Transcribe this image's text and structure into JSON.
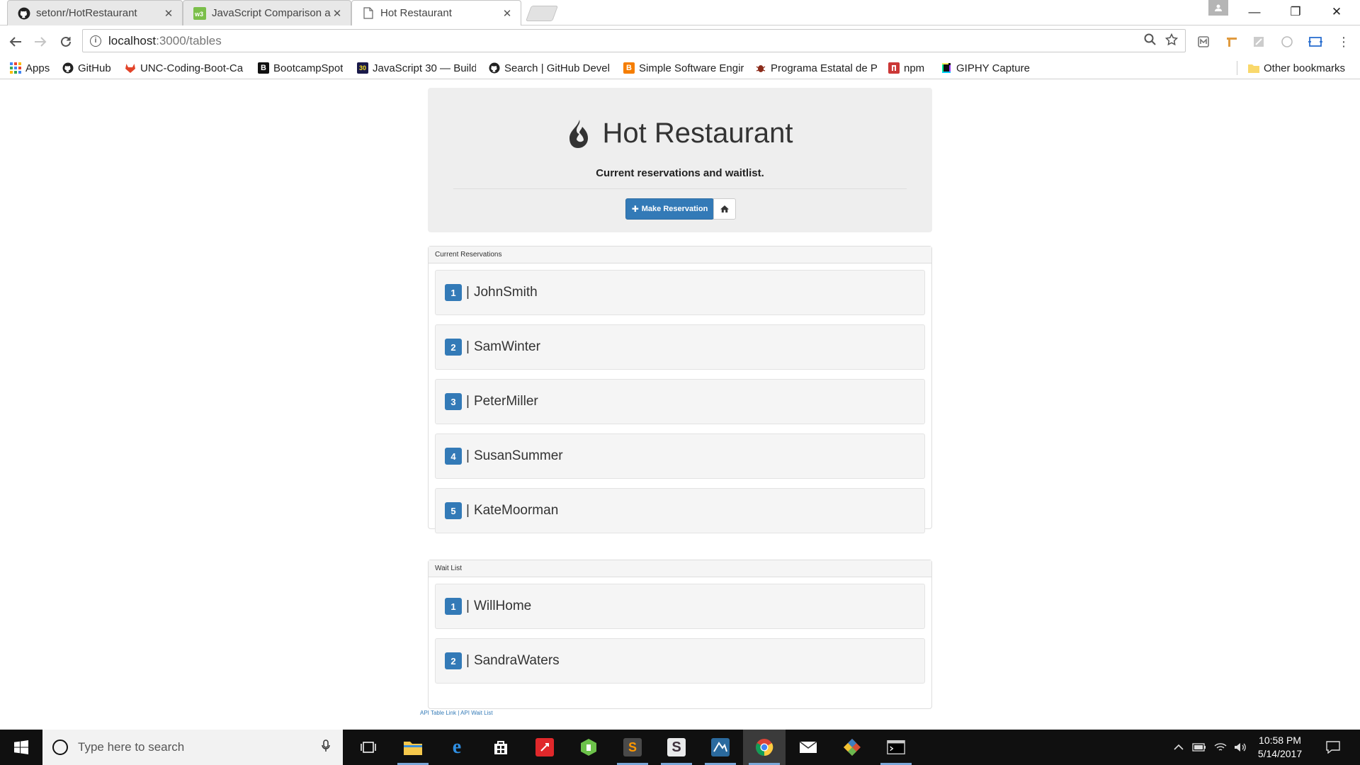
{
  "browser": {
    "tabs": [
      {
        "title": "setonr/HotRestaurant",
        "favicon": "github-icon",
        "active": false
      },
      {
        "title": "JavaScript Comparison and",
        "favicon": "w3-icon",
        "active": false
      },
      {
        "title": "Hot Restaurant",
        "favicon": "page-icon",
        "active": true
      }
    ],
    "url_host": "localhost",
    "url_path": ":3000/tables",
    "window_controls": {
      "minimize": "—",
      "restore": "❐",
      "close": "✕"
    }
  },
  "bookmarks": {
    "items": [
      {
        "label": "Apps",
        "icon": "apps-grid-icon",
        "color": "#4285f4"
      },
      {
        "label": "GitHub",
        "icon": "github-icon",
        "color": "#222222"
      },
      {
        "label": "UNC-Coding-Boot-Ca",
        "icon": "gitlab-icon",
        "color": "#e24329"
      },
      {
        "label": "BootcampSpot",
        "icon": "bootcampspot-icon",
        "color": "#111111"
      },
      {
        "label": "JavaScript 30 — Build",
        "icon": "js30-icon",
        "color": "#1a1a4a"
      },
      {
        "label": "Search | GitHub Devel",
        "icon": "github-icon",
        "color": "#222222"
      },
      {
        "label": "Simple Software Engir",
        "icon": "blogger-icon",
        "color": "#f57d00"
      },
      {
        "label": "Programa Estatal de P",
        "icon": "bug-icon",
        "color": "#8b2b1a"
      },
      {
        "label": "npm",
        "icon": "npm-icon",
        "color": "#cb3837"
      },
      {
        "label": "GIPHY Capture",
        "icon": "giphy-icon",
        "color": "#111111"
      }
    ],
    "other": "Other bookmarks"
  },
  "page": {
    "title": "Hot Restaurant",
    "subtitle": "Current reservations and waitlist.",
    "make_reservation": "Make Reservation",
    "reservations_heading": "Current Reservations",
    "reservations": [
      {
        "num": "1",
        "name": "JohnSmith"
      },
      {
        "num": "2",
        "name": "SamWinter"
      },
      {
        "num": "3",
        "name": "PeterMiller"
      },
      {
        "num": "4",
        "name": "SusanSummer"
      },
      {
        "num": "5",
        "name": "KateMoorman"
      }
    ],
    "waitlist_heading": "Wait List",
    "waitlist": [
      {
        "num": "1",
        "name": "WillHome"
      },
      {
        "num": "2",
        "name": "SandraWaters"
      }
    ],
    "separator": "|",
    "footer": {
      "api_table": "API Table Link",
      "divider": " | ",
      "api_waitlist": "API Wait List"
    },
    "accent_color": "#337ab7"
  },
  "taskbar": {
    "search_placeholder": "Type here to search",
    "time": "10:58 PM",
    "date": "5/14/2017"
  }
}
